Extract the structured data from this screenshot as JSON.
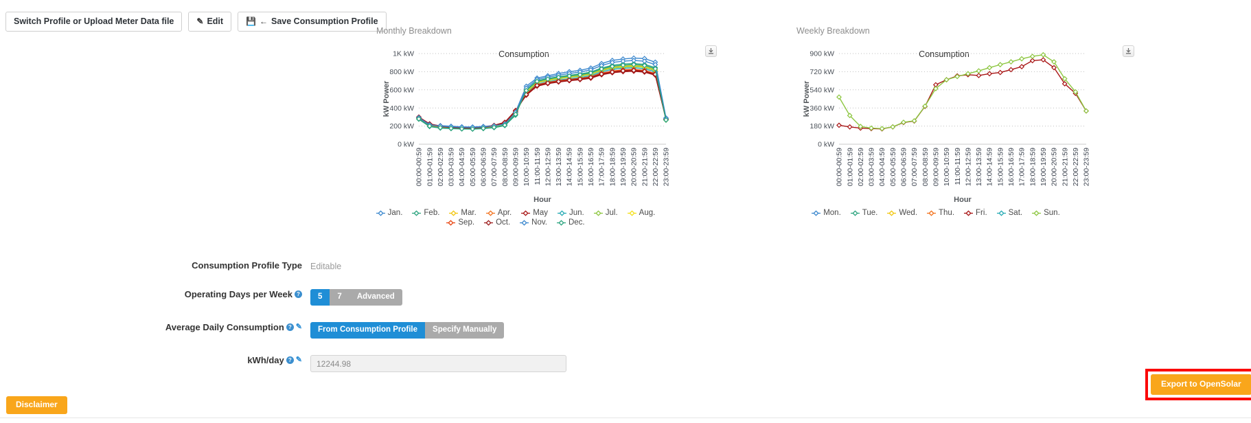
{
  "toolbar": {
    "switch_profile_label": "Switch Profile or Upload Meter Data file",
    "edit_label": "Edit",
    "edit_icon": "pencil-square-icon",
    "save_label": "Save Consumption Profile",
    "save_icon": "save-disk-icon",
    "save_arrow_icon": "arrow-left-icon"
  },
  "panels": {
    "monthly": {
      "title": "Monthly Breakdown",
      "chart_title": "Consumption",
      "download_icon": "download-icon"
    },
    "weekly": {
      "title": "Weekly Breakdown",
      "chart_title": "Consumption",
      "download_icon": "download-icon"
    }
  },
  "form": {
    "profile_type_label": "Consumption Profile Type",
    "profile_type_value": "Editable",
    "operating_days_label": "Operating Days per Week",
    "operating_days_options": [
      "5",
      "7",
      "Advanced"
    ],
    "operating_days_selected": "5",
    "avg_daily_label": "Average Daily Consumption",
    "avg_daily_options": [
      "From Consumption Profile",
      "Specify Manually"
    ],
    "avg_daily_selected": "From Consumption Profile",
    "kwh_day_label": "kWh/day",
    "kwh_day_value": "12244.98",
    "help_icon": "question-circle-icon",
    "edit_icon": "pencil-icon"
  },
  "footer": {
    "disclaimer_label": "Disclaimer",
    "export_label": "Export to OpenSolar",
    "export_highlight_color": "#fb0707",
    "accent_orange": "#f9a61b"
  },
  "chart_data": [
    {
      "id": "monthly",
      "type": "line",
      "title": "Consumption",
      "xlabel": "Hour",
      "ylabel": "kW Power",
      "ylim": [
        0,
        1000
      ],
      "yticks": [
        0,
        200,
        400,
        600,
        800,
        1000
      ],
      "ytick_labels": [
        "0 kW",
        "200 kW",
        "400 kW",
        "600 kW",
        "800 kW",
        "1K kW"
      ],
      "grid": true,
      "legend_position": "bottom",
      "categories": [
        "00:00-00:59",
        "01:00-01:59",
        "02:00-02:59",
        "03:00-03:59",
        "04:00-04:59",
        "05:00-05:59",
        "06:00-06:59",
        "07:00-07:59",
        "08:00-08:59",
        "09:00-09:59",
        "10:00-10:59",
        "11:00-11:59",
        "12:00-12:59",
        "13:00-13:59",
        "14:00-14:59",
        "15:00-15:59",
        "16:00-16:59",
        "17:00-17:59",
        "18:00-18:59",
        "19:00-19:59",
        "20:00-20:59",
        "21:00-21:59",
        "22:00-22:59",
        "23:00-23:59"
      ],
      "series": [
        {
          "name": "Jan.",
          "color": "#3a87cd",
          "values": [
            290,
            215,
            205,
            198,
            192,
            190,
            196,
            205,
            225,
            355,
            640,
            730,
            755,
            780,
            800,
            815,
            840,
            890,
            925,
            940,
            950,
            945,
            905,
            290
          ]
        },
        {
          "name": "Feb.",
          "color": "#2aa37e",
          "values": [
            275,
            195,
            178,
            172,
            168,
            166,
            172,
            182,
            205,
            320,
            600,
            700,
            725,
            745,
            760,
            775,
            795,
            840,
            870,
            885,
            890,
            880,
            845,
            265
          ]
        },
        {
          "name": "Mar.",
          "color": "#f2c60f",
          "values": [
            282,
            205,
            190,
            184,
            180,
            178,
            185,
            196,
            218,
            345,
            565,
            680,
            705,
            725,
            740,
            755,
            775,
            818,
            845,
            860,
            865,
            855,
            820,
            272
          ]
        },
        {
          "name": "Apr.",
          "color": "#f2711c",
          "values": [
            295,
            215,
            196,
            186,
            180,
            178,
            188,
            205,
            240,
            370,
            545,
            650,
            678,
            695,
            710,
            722,
            740,
            778,
            800,
            815,
            820,
            808,
            775,
            282
          ]
        },
        {
          "name": "May",
          "color": "#a81414",
          "values": [
            300,
            225,
            200,
            188,
            182,
            180,
            190,
            208,
            242,
            372,
            540,
            640,
            668,
            686,
            700,
            712,
            728,
            766,
            788,
            800,
            805,
            795,
            762,
            278
          ]
        },
        {
          "name": "Jun.",
          "color": "#25aab4",
          "values": [
            288,
            208,
            190,
            182,
            176,
            174,
            182,
            198,
            228,
            352,
            558,
            662,
            688,
            708,
            722,
            735,
            755,
            798,
            825,
            838,
            843,
            832,
            798,
            268
          ]
        },
        {
          "name": "Jul.",
          "color": "#8cc63f",
          "values": [
            285,
            202,
            186,
            178,
            172,
            170,
            178,
            192,
            220,
            340,
            572,
            678,
            702,
            722,
            738,
            750,
            770,
            812,
            840,
            852,
            858,
            848,
            812,
            266
          ]
        },
        {
          "name": "Aug.",
          "color": "#f4e019",
          "values": [
            286,
            206,
            188,
            180,
            174,
            172,
            180,
            194,
            222,
            344,
            580,
            688,
            712,
            732,
            746,
            760,
            780,
            822,
            850,
            862,
            868,
            858,
            822,
            270
          ]
        },
        {
          "name": "Sep.",
          "color": "#e8440f",
          "values": [
            292,
            212,
            194,
            184,
            178,
            176,
            185,
            200,
            234,
            360,
            552,
            656,
            682,
            700,
            714,
            726,
            744,
            784,
            806,
            820,
            825,
            814,
            780,
            276
          ]
        },
        {
          "name": "Oct.",
          "color": "#9c1b1b",
          "values": [
            298,
            220,
            198,
            186,
            180,
            178,
            188,
            204,
            238,
            366,
            548,
            648,
            674,
            692,
            706,
            718,
            736,
            774,
            796,
            810,
            815,
            804,
            770,
            274
          ]
        },
        {
          "name": "Nov.",
          "color": "#3a87cd",
          "values": [
            293,
            214,
            200,
            193,
            188,
            186,
            192,
            202,
            222,
            350,
            618,
            714,
            740,
            762,
            780,
            796,
            820,
            868,
            902,
            916,
            924,
            916,
            878,
            284
          ]
        },
        {
          "name": "Dec.",
          "color": "#2aa37e",
          "values": [
            280,
            200,
            182,
            176,
            170,
            168,
            176,
            186,
            210,
            330,
            592,
            694,
            718,
            738,
            752,
            766,
            786,
            830,
            858,
            872,
            878,
            868,
            832,
            268
          ]
        }
      ]
    },
    {
      "id": "weekly",
      "type": "line",
      "title": "Consumption",
      "xlabel": "Hour",
      "ylabel": "kW Power",
      "ylim": [
        0,
        900
      ],
      "yticks": [
        0,
        180,
        360,
        540,
        720,
        900
      ],
      "ytick_labels": [
        "0 kW",
        "180 kW",
        "360 kW",
        "540 kW",
        "720 kW",
        "900 kW"
      ],
      "grid": true,
      "legend_position": "bottom",
      "categories": [
        "00:00-00:59",
        "01:00-01:59",
        "02:00-02:59",
        "03:00-03:59",
        "04:00-04:59",
        "05:00-05:59",
        "06:00-06:59",
        "07:00-07:59",
        "08:00-08:59",
        "09:00-09:59",
        "10:00-10:59",
        "11:00-11:59",
        "12:00-12:59",
        "13:00-13:59",
        "14:00-14:59",
        "15:00-15:59",
        "16:00-16:59",
        "17:00-17:59",
        "18:00-18:59",
        "19:00-19:59",
        "20:00-20:59",
        "21:00-21:59",
        "22:00-22:59",
        "23:00-23:59"
      ],
      "series": [
        {
          "name": "Mon.",
          "color": "#3a87cd",
          "visible": false,
          "values": []
        },
        {
          "name": "Tue.",
          "color": "#2aa37e",
          "visible": false,
          "values": []
        },
        {
          "name": "Wed.",
          "color": "#f2c60f",
          "visible": false,
          "values": []
        },
        {
          "name": "Thu.",
          "color": "#f2711c",
          "visible": false,
          "values": []
        },
        {
          "name": "Fri.",
          "color": "#a81414",
          "visible": true,
          "values": [
            188,
            172,
            160,
            155,
            152,
            172,
            215,
            230,
            375,
            590,
            640,
            678,
            690,
            682,
            700,
            712,
            740,
            770,
            830,
            838,
            760,
            600,
            505,
            330
          ]
        },
        {
          "name": "Sat.",
          "color": "#25aab4",
          "visible": false,
          "values": []
        },
        {
          "name": "Sun.",
          "color": "#8cc63f",
          "visible": true,
          "values": [
            468,
            285,
            176,
            160,
            155,
            172,
            218,
            232,
            378,
            552,
            640,
            672,
            700,
            728,
            760,
            790,
            818,
            848,
            872,
            888,
            818,
            650,
            520,
            330
          ]
        }
      ]
    }
  ]
}
